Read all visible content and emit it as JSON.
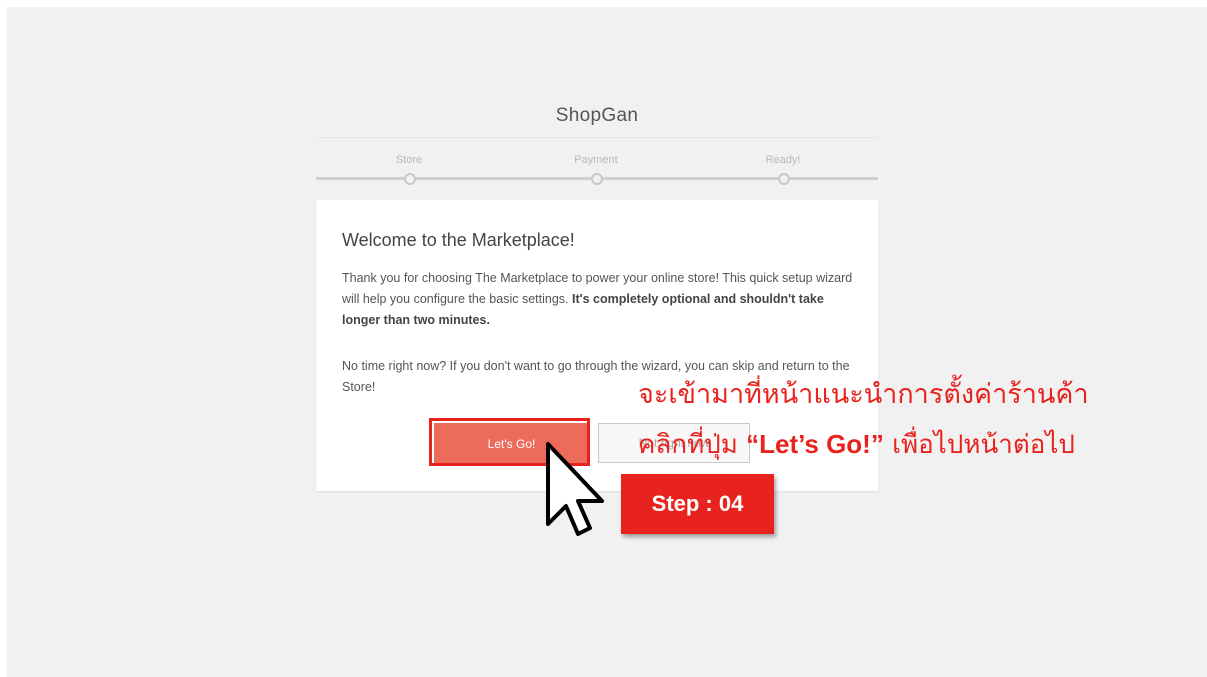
{
  "app": {
    "title": "ShopGan"
  },
  "wizard": {
    "steps": [
      {
        "label": "Store"
      },
      {
        "label": "Payment"
      },
      {
        "label": "Ready!"
      }
    ]
  },
  "card": {
    "heading": "Welcome to the Marketplace!",
    "intro_plain": "Thank you for choosing The Marketplace to power your online store! This quick setup wizard will help you configure the basic settings. ",
    "intro_bold": "It's completely optional and shouldn't take longer than two minutes.",
    "skip_text": "No time right now? If you don't want to go through the wizard, you can skip and return to the Store!",
    "primary_button": "Let's Go!",
    "secondary_button": "Not right now"
  },
  "annotation": {
    "line1": "จะเข้ามาที่หน้าแนะนำการตั้งค่าร้านค้า",
    "line2_prefix": "คลิกที่ปุ่ม ",
    "line2_bold": "“Let’s Go!”",
    "line2_suffix": " เพื่อไปหน้าต่อไป",
    "step_badge": "Step : 04",
    "color": "#e8231d"
  }
}
